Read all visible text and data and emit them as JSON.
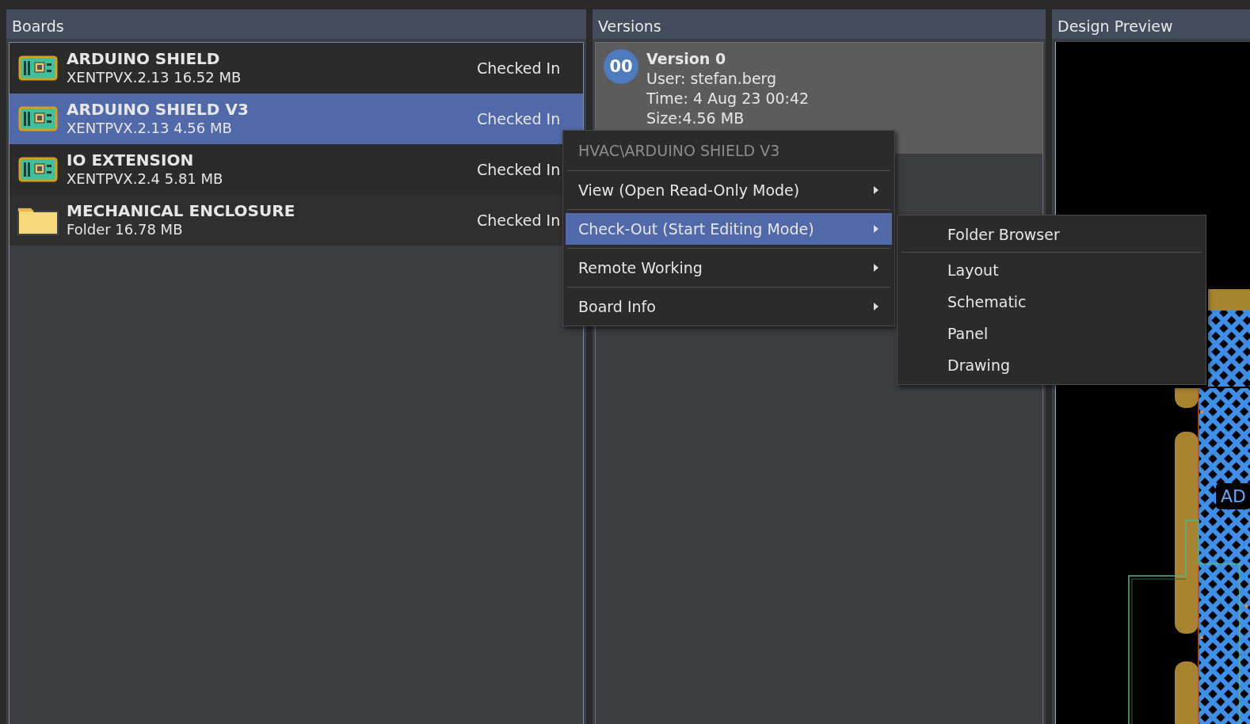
{
  "boards_panel": {
    "title": "Boards",
    "items": [
      {
        "name": "ARDUINO SHIELD",
        "detail": "XENTPVX.2.13 16.52 MB",
        "status": "Checked In",
        "kind": "board",
        "selected": false
      },
      {
        "name": "ARDUINO SHIELD V3",
        "detail": "XENTPVX.2.13 4.56 MB",
        "status": "Checked In",
        "kind": "board",
        "selected": true
      },
      {
        "name": "IO EXTENSION",
        "detail": "XENTPVX.2.4 5.81 MB",
        "status": "Checked In",
        "kind": "board",
        "selected": false
      },
      {
        "name": "MECHANICAL ENCLOSURE",
        "detail": "Folder 16.78 MB",
        "status": "Checked In",
        "kind": "folder",
        "selected": false
      }
    ]
  },
  "versions_panel": {
    "title": "Versions",
    "versions": [
      {
        "badge": "00",
        "title": "Version 0",
        "user": "User: stefan.berg",
        "time": "Time: 4 Aug 23 00:42",
        "size": "Size:4.56 MB",
        "selected": true
      }
    ]
  },
  "preview_panel": {
    "title": "Design Preview",
    "board_label": "AD"
  },
  "context_menu": {
    "header": "HVAC\\ARDUINO SHIELD V3",
    "items": [
      {
        "label": "View (Open Read-Only Mode)",
        "selected": false,
        "has_submenu": true
      },
      {
        "label": "Check-Out (Start Editing Mode)",
        "selected": true,
        "has_submenu": true
      },
      {
        "label": "Remote Working",
        "selected": false,
        "has_submenu": true
      },
      {
        "label": "Board Info",
        "selected": false,
        "has_submenu": true
      }
    ]
  },
  "submenu": {
    "sections": [
      [
        "Folder Browser"
      ],
      [
        "Layout",
        "Schematic",
        "Panel",
        "Drawing"
      ]
    ]
  }
}
